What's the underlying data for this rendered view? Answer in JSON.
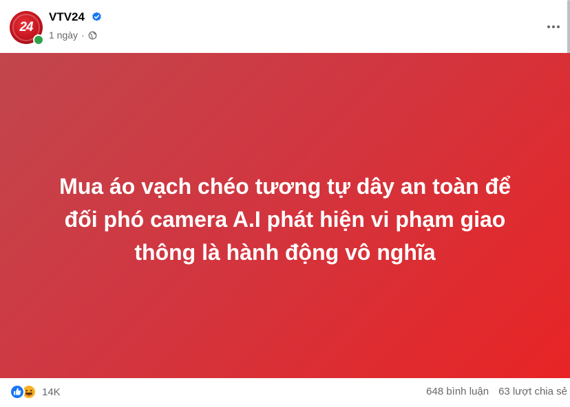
{
  "post": {
    "page_name": "VTV24",
    "avatar_text": "24",
    "time": "1 ngày",
    "separator": "·",
    "privacy_icon": "globe-icon",
    "verified_icon": "verified-badge-icon",
    "text_lines": [
      "Mua áo vạch chéo tương tự dây an toàn để",
      "đối phó camera A.I phát hiện vi phạm giao",
      "thông là hành động vô nghĩa"
    ],
    "background_colors": [
      "#c2464d",
      "#e82425"
    ]
  },
  "footer": {
    "reaction_icons": [
      "like-icon",
      "haha-icon"
    ],
    "reaction_count": "14K",
    "comments": "648 bình luận",
    "shares": "63 lượt chia sẻ"
  }
}
